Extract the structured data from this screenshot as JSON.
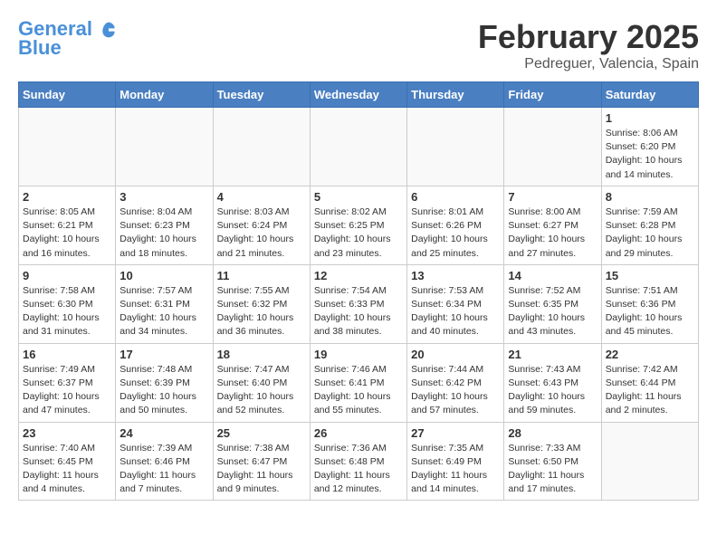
{
  "header": {
    "logo_line1": "General",
    "logo_line2": "Blue",
    "month": "February 2025",
    "location": "Pedreguer, Valencia, Spain"
  },
  "days_of_week": [
    "Sunday",
    "Monday",
    "Tuesday",
    "Wednesday",
    "Thursday",
    "Friday",
    "Saturday"
  ],
  "weeks": [
    [
      {
        "day": "",
        "info": ""
      },
      {
        "day": "",
        "info": ""
      },
      {
        "day": "",
        "info": ""
      },
      {
        "day": "",
        "info": ""
      },
      {
        "day": "",
        "info": ""
      },
      {
        "day": "",
        "info": ""
      },
      {
        "day": "1",
        "info": "Sunrise: 8:06 AM\nSunset: 6:20 PM\nDaylight: 10 hours\nand 14 minutes."
      }
    ],
    [
      {
        "day": "2",
        "info": "Sunrise: 8:05 AM\nSunset: 6:21 PM\nDaylight: 10 hours\nand 16 minutes."
      },
      {
        "day": "3",
        "info": "Sunrise: 8:04 AM\nSunset: 6:23 PM\nDaylight: 10 hours\nand 18 minutes."
      },
      {
        "day": "4",
        "info": "Sunrise: 8:03 AM\nSunset: 6:24 PM\nDaylight: 10 hours\nand 21 minutes."
      },
      {
        "day": "5",
        "info": "Sunrise: 8:02 AM\nSunset: 6:25 PM\nDaylight: 10 hours\nand 23 minutes."
      },
      {
        "day": "6",
        "info": "Sunrise: 8:01 AM\nSunset: 6:26 PM\nDaylight: 10 hours\nand 25 minutes."
      },
      {
        "day": "7",
        "info": "Sunrise: 8:00 AM\nSunset: 6:27 PM\nDaylight: 10 hours\nand 27 minutes."
      },
      {
        "day": "8",
        "info": "Sunrise: 7:59 AM\nSunset: 6:28 PM\nDaylight: 10 hours\nand 29 minutes."
      }
    ],
    [
      {
        "day": "9",
        "info": "Sunrise: 7:58 AM\nSunset: 6:30 PM\nDaylight: 10 hours\nand 31 minutes."
      },
      {
        "day": "10",
        "info": "Sunrise: 7:57 AM\nSunset: 6:31 PM\nDaylight: 10 hours\nand 34 minutes."
      },
      {
        "day": "11",
        "info": "Sunrise: 7:55 AM\nSunset: 6:32 PM\nDaylight: 10 hours\nand 36 minutes."
      },
      {
        "day": "12",
        "info": "Sunrise: 7:54 AM\nSunset: 6:33 PM\nDaylight: 10 hours\nand 38 minutes."
      },
      {
        "day": "13",
        "info": "Sunrise: 7:53 AM\nSunset: 6:34 PM\nDaylight: 10 hours\nand 40 minutes."
      },
      {
        "day": "14",
        "info": "Sunrise: 7:52 AM\nSunset: 6:35 PM\nDaylight: 10 hours\nand 43 minutes."
      },
      {
        "day": "15",
        "info": "Sunrise: 7:51 AM\nSunset: 6:36 PM\nDaylight: 10 hours\nand 45 minutes."
      }
    ],
    [
      {
        "day": "16",
        "info": "Sunrise: 7:49 AM\nSunset: 6:37 PM\nDaylight: 10 hours\nand 47 minutes."
      },
      {
        "day": "17",
        "info": "Sunrise: 7:48 AM\nSunset: 6:39 PM\nDaylight: 10 hours\nand 50 minutes."
      },
      {
        "day": "18",
        "info": "Sunrise: 7:47 AM\nSunset: 6:40 PM\nDaylight: 10 hours\nand 52 minutes."
      },
      {
        "day": "19",
        "info": "Sunrise: 7:46 AM\nSunset: 6:41 PM\nDaylight: 10 hours\nand 55 minutes."
      },
      {
        "day": "20",
        "info": "Sunrise: 7:44 AM\nSunset: 6:42 PM\nDaylight: 10 hours\nand 57 minutes."
      },
      {
        "day": "21",
        "info": "Sunrise: 7:43 AM\nSunset: 6:43 PM\nDaylight: 10 hours\nand 59 minutes."
      },
      {
        "day": "22",
        "info": "Sunrise: 7:42 AM\nSunset: 6:44 PM\nDaylight: 11 hours\nand 2 minutes."
      }
    ],
    [
      {
        "day": "23",
        "info": "Sunrise: 7:40 AM\nSunset: 6:45 PM\nDaylight: 11 hours\nand 4 minutes."
      },
      {
        "day": "24",
        "info": "Sunrise: 7:39 AM\nSunset: 6:46 PM\nDaylight: 11 hours\nand 7 minutes."
      },
      {
        "day": "25",
        "info": "Sunrise: 7:38 AM\nSunset: 6:47 PM\nDaylight: 11 hours\nand 9 minutes."
      },
      {
        "day": "26",
        "info": "Sunrise: 7:36 AM\nSunset: 6:48 PM\nDaylight: 11 hours\nand 12 minutes."
      },
      {
        "day": "27",
        "info": "Sunrise: 7:35 AM\nSunset: 6:49 PM\nDaylight: 11 hours\nand 14 minutes."
      },
      {
        "day": "28",
        "info": "Sunrise: 7:33 AM\nSunset: 6:50 PM\nDaylight: 11 hours\nand 17 minutes."
      },
      {
        "day": "",
        "info": ""
      }
    ]
  ]
}
